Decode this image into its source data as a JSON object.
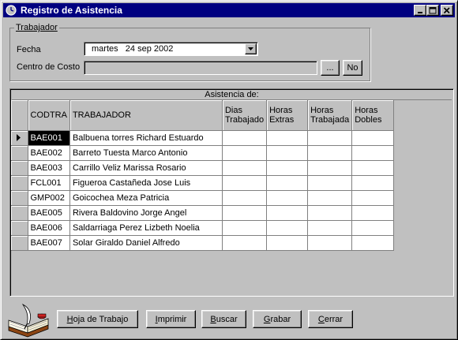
{
  "window": {
    "title": "Registro de Asistencia"
  },
  "trabajador": {
    "group_label": "Trabajador",
    "fecha_label": "Fecha",
    "fecha_value": "martes   24 sep 2002",
    "centro_label": "Centro de Costo",
    "centro_value": "",
    "browse_label": "...",
    "no_label": "No"
  },
  "grid": {
    "group_header": "Asistencia de:",
    "columns": {
      "codtra": "CODTRA",
      "trabajador": "TRABAJADOR",
      "dias_1": "Dias",
      "dias_2": "Trabajado",
      "hextras_1": "Horas",
      "hextras_2": "Extras",
      "htrab_1": "Horas",
      "htrab_2": "Trabajada",
      "hdobles_1": "Horas",
      "hdobles_2": "Dobles"
    },
    "rows": [
      {
        "codtra": "BAE001",
        "trabajador": "Balbuena torres Richard Estuardo"
      },
      {
        "codtra": "BAE002",
        "trabajador": "Barreto Tuesta Marco Antonio"
      },
      {
        "codtra": "BAE003",
        "trabajador": "Carrillo Veliz Marissa Rosario"
      },
      {
        "codtra": "FCL001",
        "trabajador": "Figueroa Castañeda Jose Luis"
      },
      {
        "codtra": "GMP002",
        "trabajador": "Goicochea Meza Patricia"
      },
      {
        "codtra": "BAE005",
        "trabajador": "Rivera Baldovino Jorge Angel"
      },
      {
        "codtra": "BAE006",
        "trabajador": "Saldarriaga Perez Lizbeth Noelia"
      },
      {
        "codtra": "BAE007",
        "trabajador": "Solar Giraldo Daniel Alfredo"
      }
    ]
  },
  "buttons": {
    "hoja": {
      "pre": "",
      "key": "H",
      "post": "oja de Trabajo"
    },
    "imprimir": {
      "pre": "",
      "key": "I",
      "post": "mprimir"
    },
    "buscar": {
      "pre": "",
      "key": "B",
      "post": "uscar"
    },
    "grabar": {
      "pre": "",
      "key": "G",
      "post": "rabar"
    },
    "cerrar": {
      "pre": "",
      "key": "C",
      "post": "errar"
    }
  },
  "icons": {
    "app": "clock-icon",
    "book": "book-quill-icon",
    "row_pointer": "row-pointer-icon"
  },
  "colors": {
    "titlebar": "#000080",
    "face": "#c0c0c0",
    "selected_cell": "#000000"
  }
}
